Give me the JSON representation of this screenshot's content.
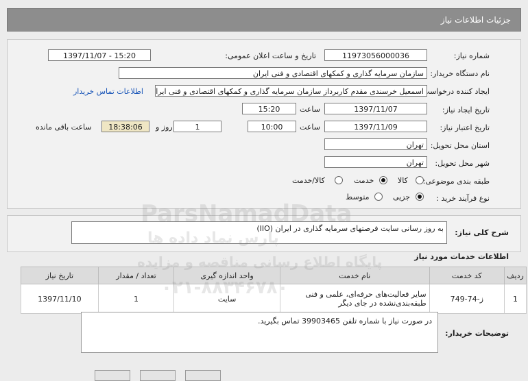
{
  "header": {
    "title": "جزئیات اطلاعات نیاز"
  },
  "form": {
    "need_number_label": "شماره نیاز:",
    "need_number": "11973056000036",
    "announce_label": "تاریخ و ساعت اعلان عمومی:",
    "announce_value": "1397/11/07 - 15:20",
    "buyer_org_label": "نام دستگاه خریدار:",
    "buyer_org": "سازمان سرمایه گذاری و کمکهای اقتصادی و فنی ایران",
    "requester_label": "ایجاد کننده درخواست:",
    "requester": "اسمعیل خرسندی مقدم کاربرداز سازمان سرمایه گذاری و کمکهای اقتصادی و فنی ایران",
    "contact_link": "اطلاعات تماس خریدار",
    "created_label": "تاریخ ایجاد نیاز:",
    "created_date": "1397/11/07",
    "time_label": "ساعت",
    "created_time": "15:20",
    "valid_label": "تاریخ اعتبار نیاز:",
    "valid_date": "1397/11/09",
    "valid_time": "10:00",
    "days_value": "1",
    "days_label": "روز و",
    "remaining_value": "18:38:06",
    "remaining_label": "ساعت باقی مانده",
    "province_label": "استان محل تحویل:",
    "province": "تهران",
    "city_label": "شهر محل تحویل:",
    "city": "تهران",
    "category_label": "طبقه بندی موضوعی:",
    "category_options": [
      "کالا",
      "خدمت",
      "کالا/خدمت"
    ],
    "category_selected": "خدمت",
    "process_label": "نوع فرآیند خرید :",
    "process_options": [
      "جزیی",
      "متوسط"
    ],
    "process_selected": "جزیی"
  },
  "description": {
    "label": "شرح کلی نیاز:",
    "value": "به روز رسانی سایت فرصتهای سرمایه گذاری در ایران (IIO)"
  },
  "services": {
    "title": "اطلاعات خدمات مورد نیاز",
    "columns": [
      "ردیف",
      "کد خدمت",
      "نام خدمت",
      "واحد اندازه گیری",
      "تعداد / مقدار",
      "تاریخ نیاز"
    ],
    "rows": [
      [
        "1",
        "ز-74-749",
        "سایر فعالیت‌های حرفه‌ای، علمی و فنی طبقه‌بندی‌نشده در جای دیگر",
        "سایت",
        "1",
        "1397/11/10"
      ]
    ]
  },
  "notes": {
    "label": "توضیحات خریدار:",
    "value": "در صورت نیاز با شماره تلفن 39903465 تماس بگیرید."
  },
  "watermarks": [
    "ParsNamadData",
    "پارس نماد داده ها",
    "پایگاه اطلاع رسانی مناقصه و مزایده",
    "۰۲۱-۸۸۳۴۶۷۸۰"
  ]
}
